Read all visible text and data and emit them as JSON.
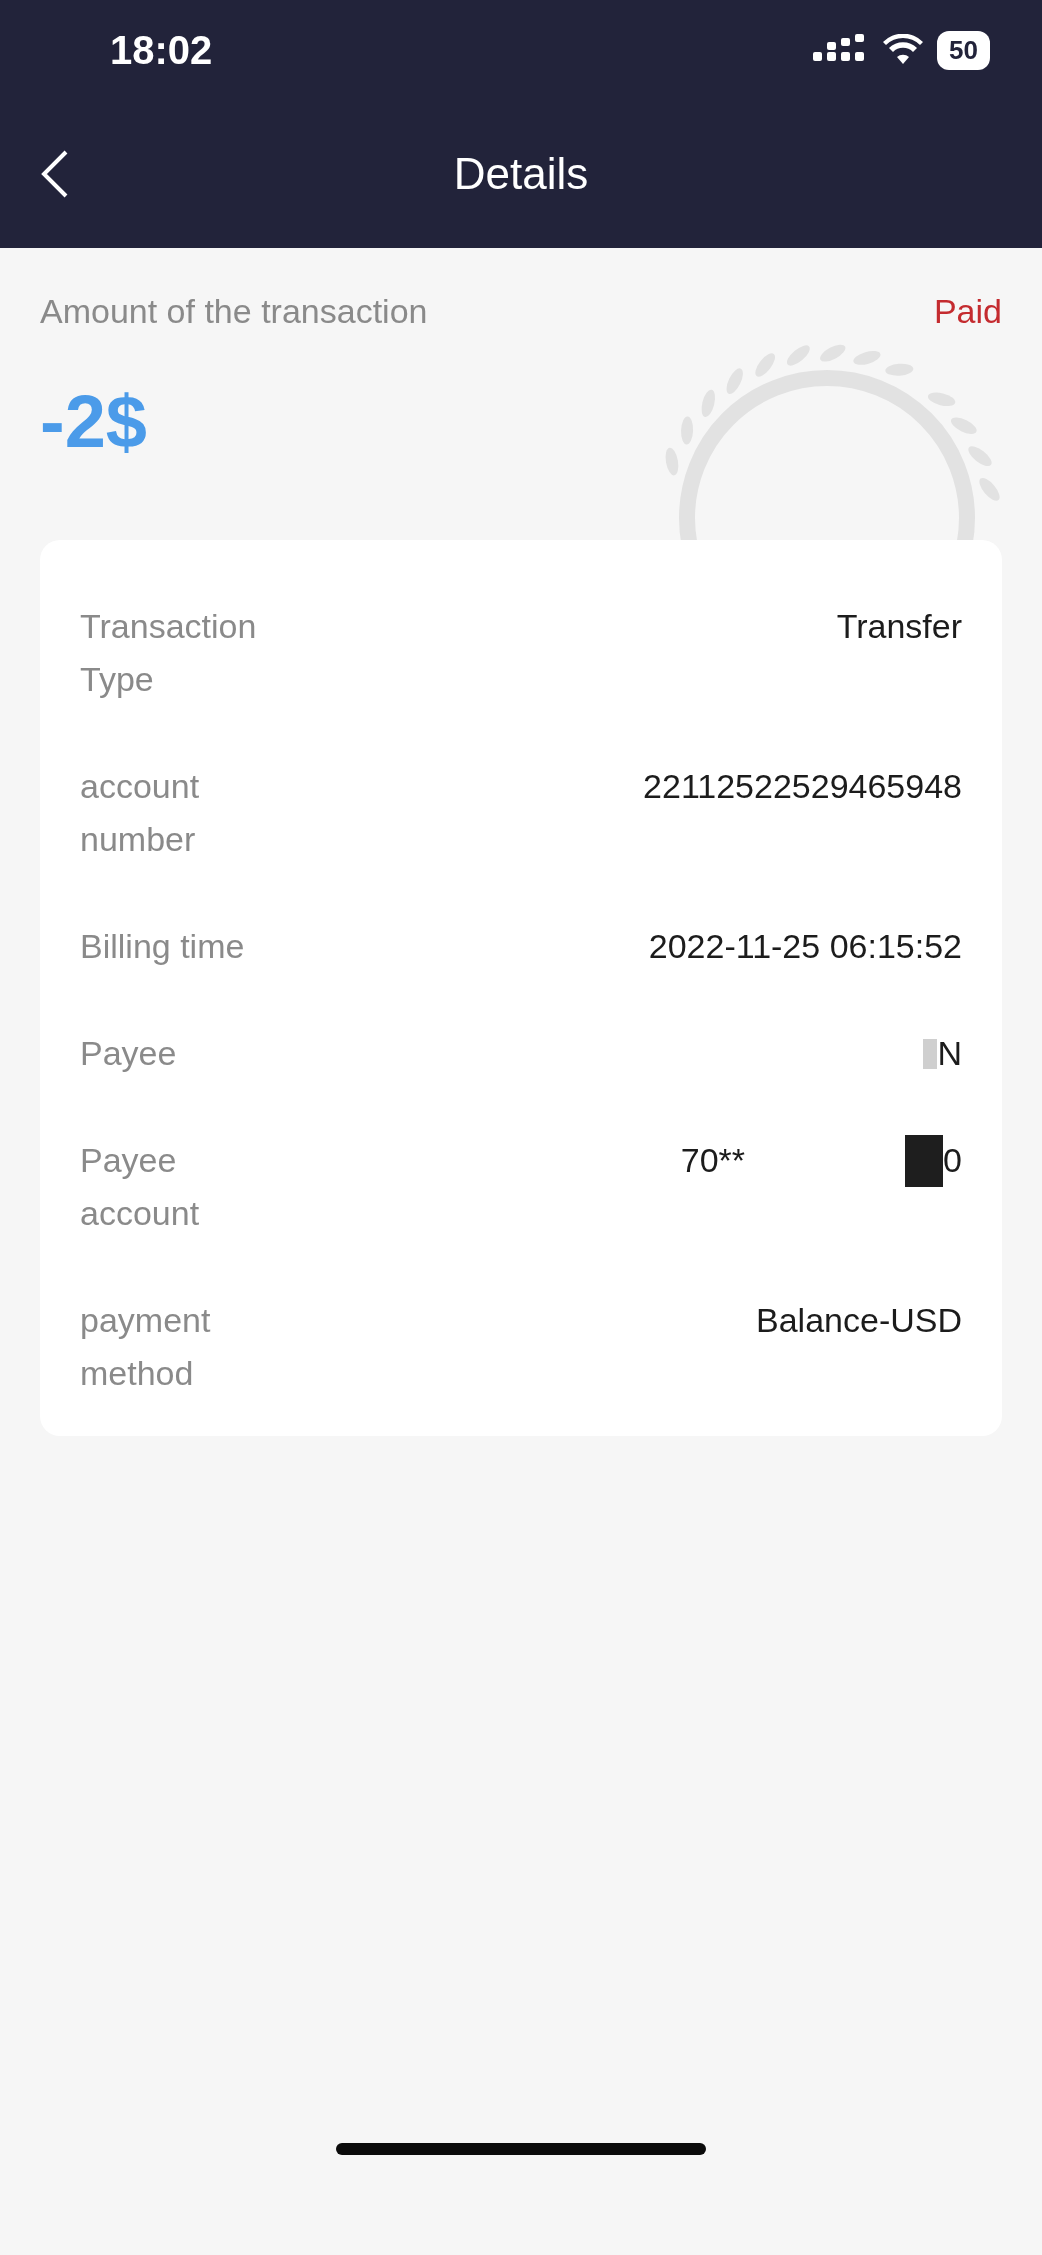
{
  "status_bar": {
    "time": "18:02",
    "battery": "50"
  },
  "header": {
    "title": "Details"
  },
  "summary": {
    "label": "Amount of the transaction",
    "status": "Paid",
    "amount": "-2$"
  },
  "details": [
    {
      "label": "Transaction Type",
      "value": "Transfer",
      "redacted": false
    },
    {
      "label": "account number",
      "value": "22112522529465948",
      "redacted": false
    },
    {
      "label": "Billing time",
      "value": "2022-11-25 06:15:52",
      "redacted": false
    },
    {
      "label": "Payee",
      "value": "N",
      "redacted": true
    },
    {
      "label": "Payee account",
      "value": "70**",
      "suffix": "0",
      "redacted": true
    },
    {
      "label": "payment method",
      "value": "Balance-USD",
      "redacted": false
    }
  ]
}
